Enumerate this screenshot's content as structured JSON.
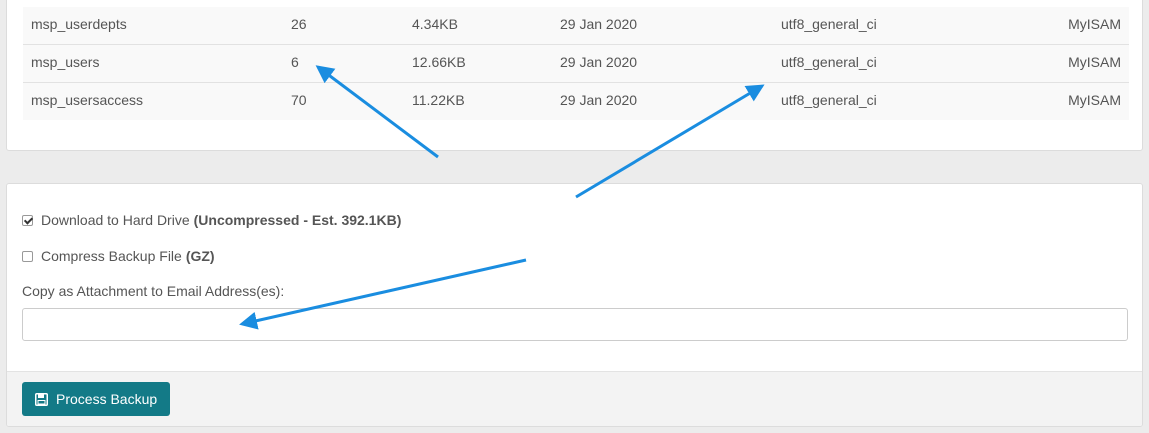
{
  "tables": {
    "rows": [
      {
        "name": "msp_userdepts",
        "rows": "26",
        "size": "4.34KB",
        "date": "29 Jan 2020",
        "collation": "utf8_general_ci",
        "engine": "MyISAM"
      },
      {
        "name": "msp_users",
        "rows": "6",
        "size": "12.66KB",
        "date": "29 Jan 2020",
        "collation": "utf8_general_ci",
        "engine": "MyISAM"
      },
      {
        "name": "msp_usersaccess",
        "rows": "70",
        "size": "11.22KB",
        "date": "29 Jan 2020",
        "collation": "utf8_general_ci",
        "engine": "MyISAM"
      }
    ]
  },
  "options": {
    "download": {
      "label": "Download to Hard Drive",
      "detail": "(Uncompressed - Est. 392.1KB)",
      "checked": true
    },
    "compress": {
      "label": "Compress Backup File",
      "detail": "(GZ)",
      "checked": false
    }
  },
  "email": {
    "label": "Copy as Attachment to Email Address(es):",
    "value": "",
    "placeholder": ""
  },
  "actions": {
    "process_label": "Process Backup",
    "button_color": "#137a87"
  },
  "icons": {
    "process_button": "save-icon"
  },
  "annotation_color": "#1a8de0"
}
